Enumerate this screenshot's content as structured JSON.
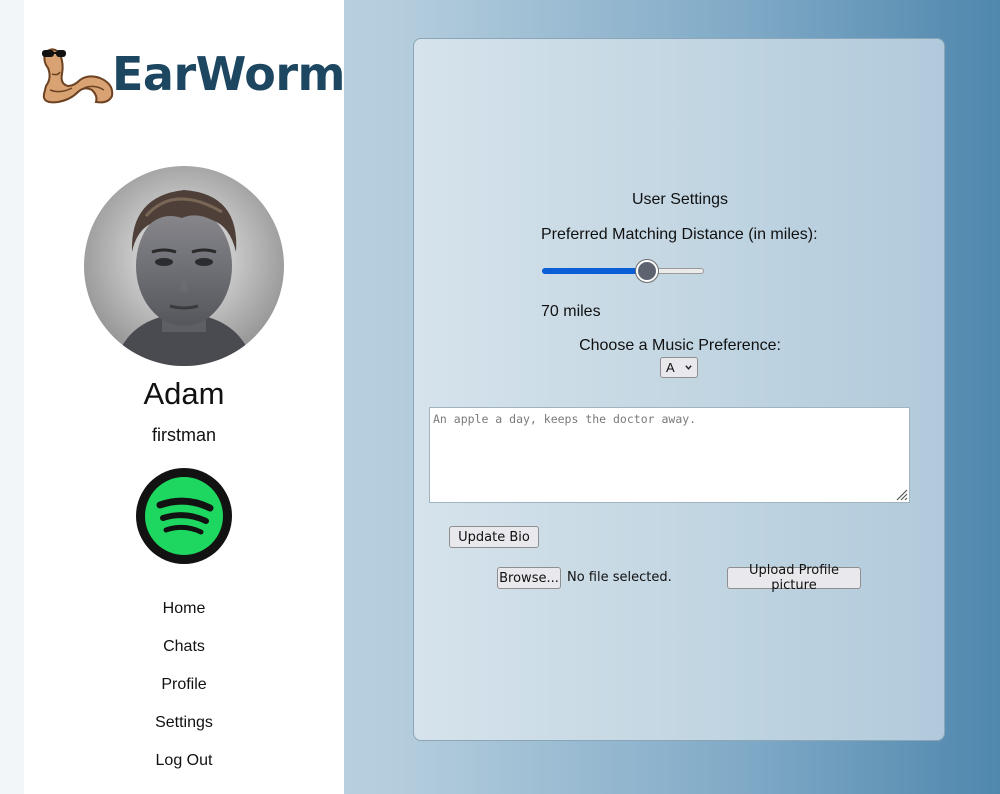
{
  "brand": {
    "name": "EarWorm"
  },
  "profile": {
    "display_name": "Adam",
    "username": "firstman"
  },
  "nav": {
    "items": [
      "Home",
      "Chats",
      "Profile",
      "Settings",
      "Log Out"
    ]
  },
  "settings": {
    "title": "User Settings",
    "distance_label": "Preferred Matching Distance (in miles):",
    "distance_fraction": 0.67,
    "distance_value": "70 miles",
    "music_label": "Choose a Music Preference:",
    "music_selected": "A",
    "bio_placeholder": "An apple a day, keeps the doctor away.",
    "update_bio_label": "Update Bio",
    "browse_label": "Browse...",
    "file_status": "No file selected.",
    "upload_label": "Upload Profile picture"
  },
  "colors": {
    "brand_text": "#1d4660",
    "spotify_green": "#1ed760",
    "slider_fill": "#0a5fd6"
  },
  "icons": {
    "logo": "worm-with-sunglasses-icon",
    "music_service": "spotify-icon",
    "select_caret": "chevron-down-icon"
  }
}
